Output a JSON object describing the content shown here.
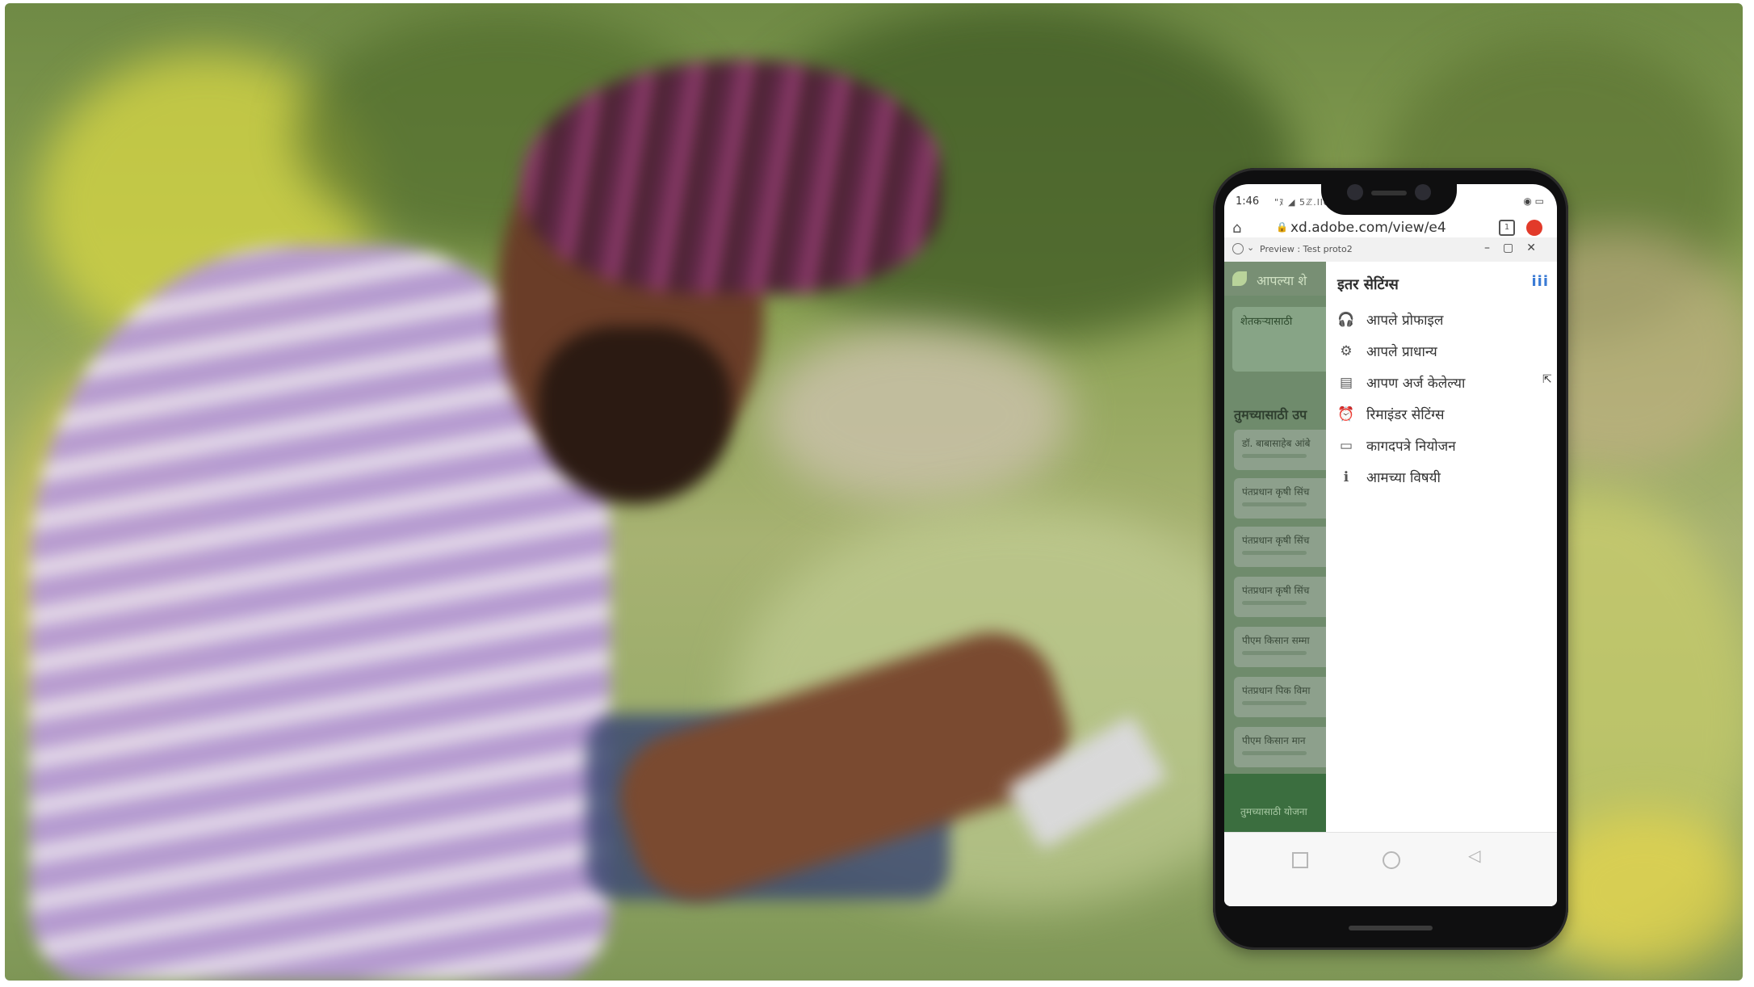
{
  "status_bar": {
    "time": "1:46",
    "signals": "\"ﾇ ◢ 5ℤ.lle",
    "battery": "◉ ▭"
  },
  "browser": {
    "url": "xd.adobe.com/view/e4",
    "tabs_count": "1"
  },
  "preview_bar": {
    "title": "Preview : Test proto2"
  },
  "app": {
    "header_title": "आपल्या शे",
    "banner_text": "शेतकऱ्यासाठी",
    "section_title": "तुमच्यासाठी उप",
    "cards": [
      "डॉ. बाबासाहेब आंबे",
      "पंतप्रधान कृषी सिंच",
      "पंतप्रधान कृषी सिंच",
      "पंतप्रधान कृषी सिंच",
      "पीएम किसान सम्मा",
      "पंतप्रधान पिक विमा",
      "पीएम किसान मान"
    ],
    "fab_label": "तुमच्यासाठी योजना"
  },
  "drawer": {
    "title": "इतर सेटिंग्स",
    "close_icon": "iii",
    "items": [
      {
        "icon": "headset-icon",
        "glyph": "🎧",
        "label": "आपले प्रोफाइल"
      },
      {
        "icon": "gear-icon",
        "glyph": "⚙",
        "label": "आपले प्राधान्य"
      },
      {
        "icon": "document-icon",
        "glyph": "▤",
        "label": "आपण अर्ज केलेल्या"
      },
      {
        "icon": "alarm-icon",
        "glyph": "⏰",
        "label": "रिमाइंडर सेटिंग्स"
      },
      {
        "icon": "id-card-icon",
        "glyph": "▭",
        "label": "कागदपत्रे नियोजन"
      },
      {
        "icon": "info-icon",
        "glyph": "ℹ",
        "label": "आमच्या विषयी"
      }
    ]
  }
}
